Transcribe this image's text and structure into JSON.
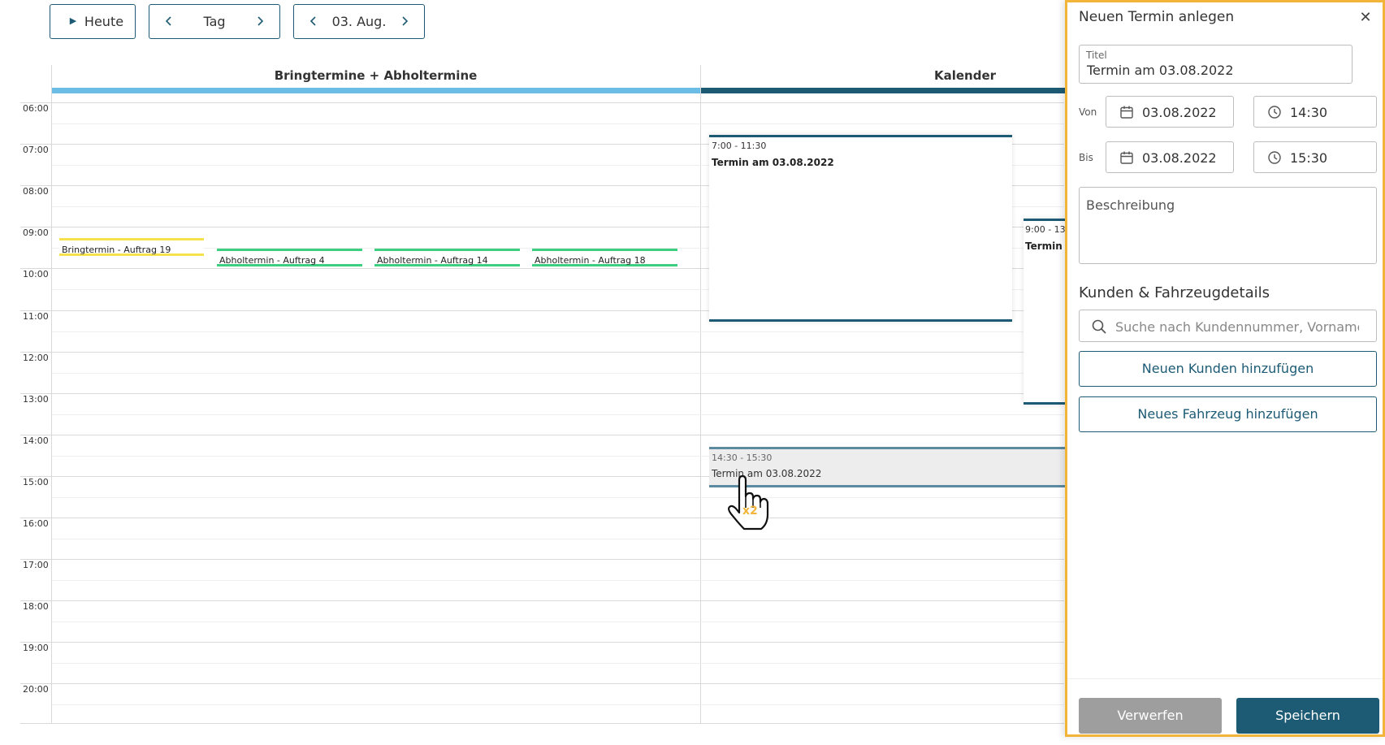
{
  "toolbar": {
    "today_label": "Heute",
    "view_label": "Tag",
    "date_label": "03. Aug."
  },
  "calendar": {
    "columns": [
      {
        "name": "Bringtermine + Abholtermine",
        "color": "#6cbde6"
      },
      {
        "name": "Kalender",
        "color": "#1d5b75"
      }
    ],
    "hours": [
      "06:00",
      "07:00",
      "08:00",
      "09:00",
      "10:00",
      "11:00",
      "12:00",
      "13:00",
      "14:00",
      "15:00",
      "16:00",
      "17:00",
      "18:00",
      "19:00",
      "20:00"
    ],
    "chips": [
      {
        "label": "Bringtermin - Auftrag 19",
        "type": "yellow"
      },
      {
        "label": "Abholtermin - Auftrag 4",
        "type": "green"
      },
      {
        "label": "Abholtermin - Auftrag 14",
        "type": "green"
      },
      {
        "label": "Abholtermin - Auftrag 18",
        "type": "green"
      }
    ],
    "events": [
      {
        "time": "7:00 - 11:30",
        "title": "Termin am 03.08.2022"
      },
      {
        "time": "9:00 - 13",
        "title": "Termin a"
      },
      {
        "time": "14:30 - 15:30",
        "title": "Termin am 03.08.2022"
      }
    ],
    "cursor_badge": "x2"
  },
  "panel": {
    "title": "Neuen Termin anlegen",
    "title_field": {
      "label": "Titel",
      "value": "Termin am 03.08.2022"
    },
    "from": {
      "label": "Von",
      "date": "03.08.2022",
      "time": "14:30"
    },
    "to": {
      "label": "Bis",
      "date": "03.08.2022",
      "time": "15:30"
    },
    "description_placeholder": "Beschreibung",
    "section_title": "Kunden & Fahrzeugdetails",
    "search_placeholder": "Suche nach Kundennummer, Vorname, Nachname",
    "add_customer_label": "Neuen Kunden hinzufügen",
    "add_vehicle_label": "Neues Fahrzeug hinzufügen",
    "discard_label": "Verwerfen",
    "save_label": "Speichern"
  },
  "colors": {
    "primary": "#1d5b75",
    "light_blue": "#6cbde6",
    "panel_border": "#f2b53a",
    "yellow": "#f5e14b",
    "green": "#3ccf80",
    "discard_bg": "#9e9e9e"
  }
}
